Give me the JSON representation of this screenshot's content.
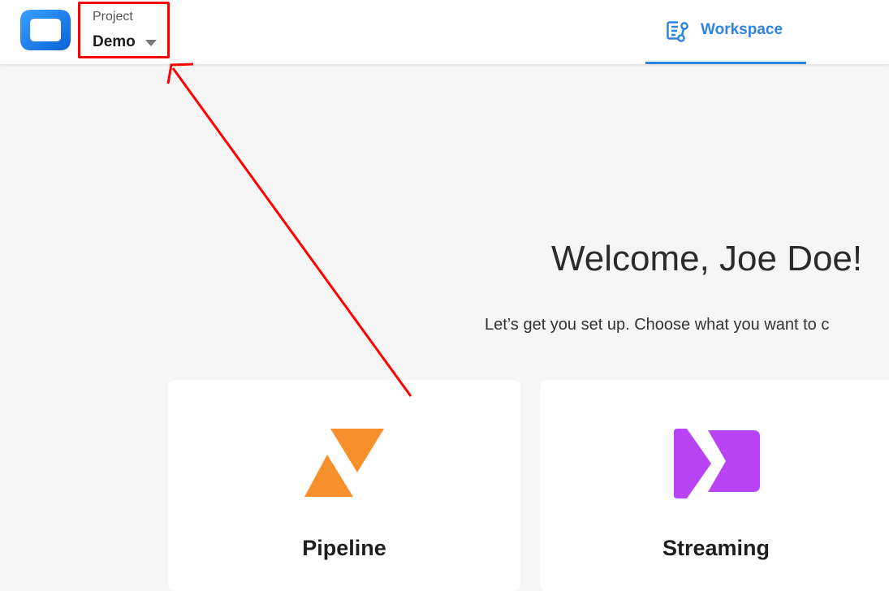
{
  "header": {
    "project_label": "Project",
    "project_value": "Demo",
    "workspace_tab_label": "Workspace"
  },
  "welcome": {
    "title": "Welcome, Joe Doe!",
    "subtitle": "Let’s get you set up. Choose what you want to c"
  },
  "cards": [
    {
      "title": "Pipeline",
      "icon": "pipeline-logo-icon",
      "color": "#f7902a"
    },
    {
      "title": "Streaming",
      "icon": "streaming-logo-icon",
      "color": "#b944f5"
    }
  ],
  "colors": {
    "accent": "#2f84e3",
    "annotation": "#ff0000",
    "logo_blue": "#1e7ff0"
  }
}
